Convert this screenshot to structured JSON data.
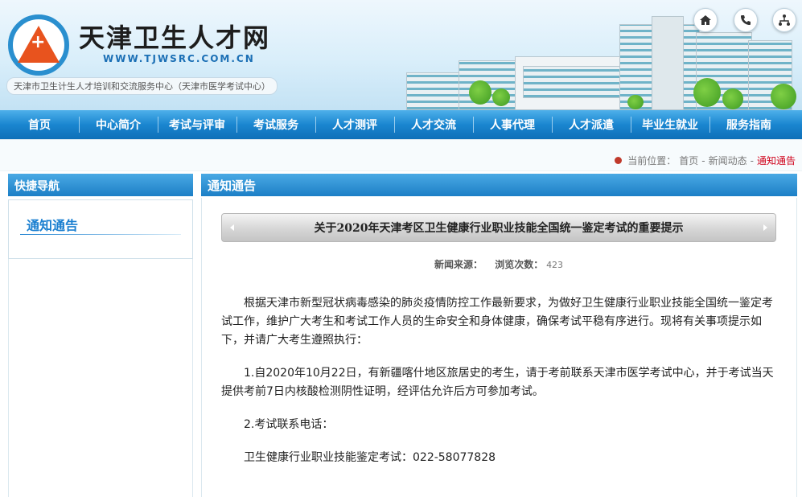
{
  "header": {
    "title": "天津卫生人才网",
    "url": "WWW.TJWSRC.COM.CN",
    "subtitle": "天津市卫生计生人才培训和交流服务中心（天津市医学考试中心）",
    "icons": [
      "home-icon",
      "phone-icon",
      "sitemap-icon"
    ]
  },
  "nav": {
    "items": [
      "首页",
      "中心简介",
      "考试与评审",
      "考试服务",
      "人才测评",
      "人才交流",
      "人事代理",
      "人才派遣",
      "毕业生就业",
      "服务指南"
    ]
  },
  "breadcrumb": {
    "label": "当前位置：",
    "home": "首页",
    "sep1": "-",
    "news": "新闻动态",
    "sep2": "-",
    "current": "通知通告"
  },
  "sidebar": {
    "heading": "快捷导航",
    "link": "通知通告"
  },
  "main": {
    "heading": "通知通告",
    "article": {
      "title": "关于2020年天津考区卫生健康行业职业技能全国统一鉴定考试的重要提示",
      "source_label": "新闻来源：",
      "views_label": "浏览次数：",
      "views": "423",
      "paragraphs": [
        "根据天津市新型冠状病毒感染的肺炎疫情防控工作最新要求，为做好卫生健康行业职业技能全国统一鉴定考试工作，维护广大考生和考试工作人员的生命安全和身体健康，确保考试平稳有序进行。现将有关事项提示如下，并请广大考生遵照执行：",
        "1.自2020年10月22日，有新疆喀什地区旅居史的考生，请于考前联系天津市医学考试中心，并于考试当天提供考前7日内核酸检测阴性证明，经评估允许后方可参加考试。",
        "2.考试联系电话：",
        "卫生健康行业职业技能鉴定考试：022-58077828"
      ]
    }
  },
  "colors": {
    "nav_blue": "#1a86d0",
    "link_blue": "#1a7fd0",
    "current_red": "#d0021b",
    "logo_orange": "#e8531e"
  }
}
